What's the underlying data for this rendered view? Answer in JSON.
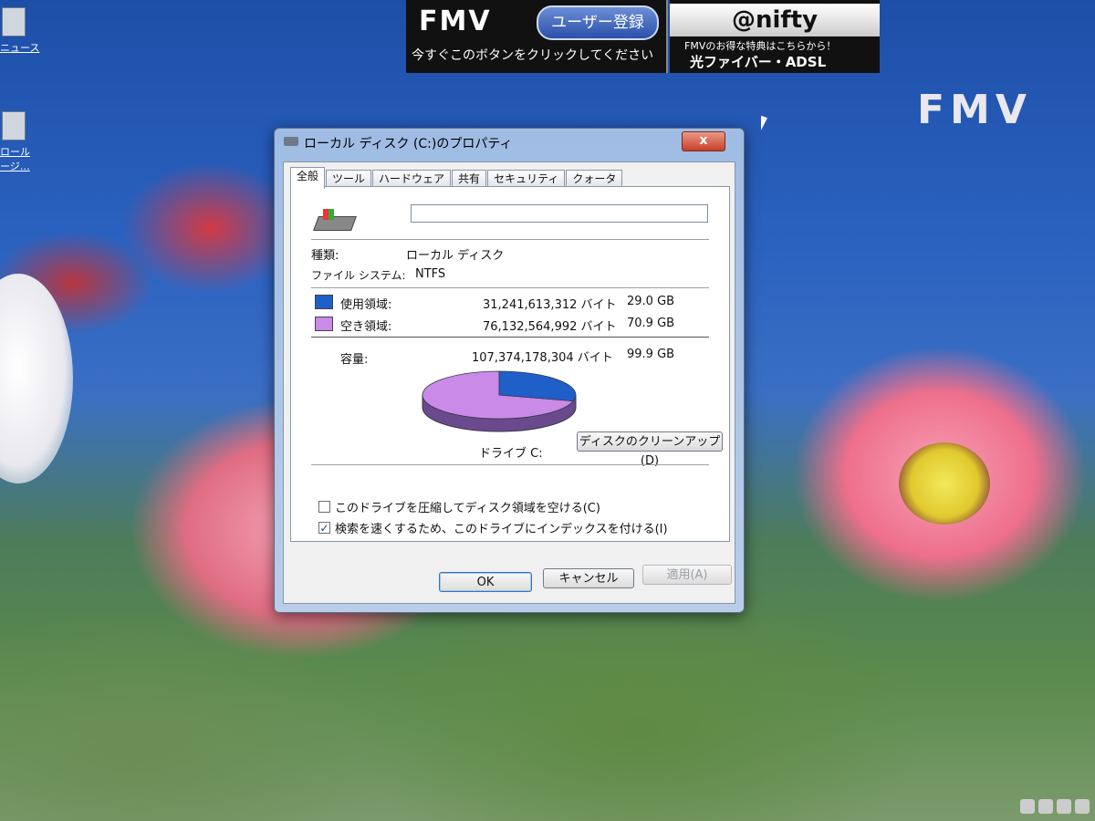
{
  "banner": {
    "logo": "FMV",
    "register": "ユーザー登録",
    "register_sub": "今すぐこのボタンをクリックしてください",
    "nifty": "@nifty",
    "nifty_line1": "FMVのお得な特典はこちらから！",
    "nifty_line2": "光ファイバー・ADSL"
  },
  "desktop": {
    "logo": "FMV",
    "icons": [
      "ニュース",
      "ロール",
      "ージ…"
    ]
  },
  "dialog": {
    "title": "ローカル ディスク (C:)のプロパティ",
    "close": "x",
    "tabs": [
      "全般",
      "ツール",
      "ハードウェア",
      "共有",
      "セキュリティ",
      "クォータ"
    ],
    "active_tab": 0,
    "name_value": "",
    "type_label": "種類:",
    "type_value": "ローカル ディスク",
    "fs_label": "ファイル システム:",
    "fs_value": "NTFS",
    "used_label": "使用領域:",
    "used_bytes": "31,241,613,312 バイト",
    "used_gb": "29.0 GB",
    "free_label": "空き領域:",
    "free_bytes": "76,132,564,992 バイト",
    "free_gb": "70.9 GB",
    "cap_label": "容量:",
    "cap_bytes": "107,374,178,304 バイト",
    "cap_gb": "99.9 GB",
    "drive_label": "ドライブ C:",
    "cleanup_button": "ディスクのクリーンアップ(D)",
    "compress_label": "このドライブを圧縮してディスク領域を空ける(C)",
    "compress_checked": false,
    "index_label": "検索を速くするため、このドライブにインデックスを付ける(I)",
    "index_checked": true,
    "ok": "OK",
    "cancel": "キャンセル",
    "apply": "適用(A)",
    "used_color": "#1f5fc8",
    "free_color": "#c98ae8",
    "used_fraction": 0.291
  }
}
